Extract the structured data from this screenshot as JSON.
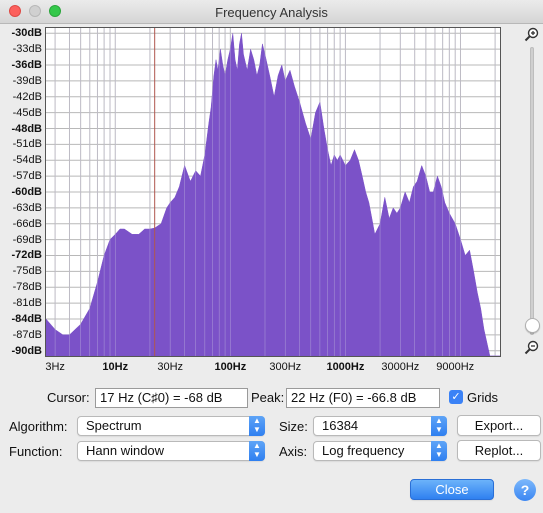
{
  "window": {
    "title": "Frequency Analysis"
  },
  "chart_data": {
    "type": "area",
    "title": "",
    "xlabel": "",
    "ylabel": "",
    "x_scale": "log",
    "xlim": [
      2.5,
      22050
    ],
    "ylim": [
      -91,
      -29
    ],
    "grid": true,
    "color": "#7b52c8",
    "y_ticks": [
      "-30dB",
      "-33dB",
      "-36dB",
      "-39dB",
      "-42dB",
      "-45dB",
      "-48dB",
      "-51dB",
      "-54dB",
      "-57dB",
      "-60dB",
      "-63dB",
      "-66dB",
      "-69dB",
      "-72dB",
      "-75dB",
      "-78dB",
      "-81dB",
      "-84dB",
      "-87dB",
      "-90dB"
    ],
    "y_ticks_bold": [
      "-30dB",
      "-36dB",
      "-48dB",
      "-60dB",
      "-72dB",
      "-84dB",
      "-90dB"
    ],
    "x_ticks": [
      "3Hz",
      "10Hz",
      "30Hz",
      "100Hz",
      "300Hz",
      "1000Hz",
      "3000Hz",
      "9000Hz"
    ],
    "x_ticks_bold": [
      "10Hz",
      "100Hz",
      "1000Hz"
    ],
    "cursor_hz": 22,
    "points": [
      [
        2.5,
        -84
      ],
      [
        3,
        -86
      ],
      [
        3.5,
        -87
      ],
      [
        4,
        -87
      ],
      [
        5,
        -85
      ],
      [
        6,
        -82
      ],
      [
        7,
        -77
      ],
      [
        8,
        -72
      ],
      [
        9,
        -69
      ],
      [
        10,
        -68
      ],
      [
        11,
        -67
      ],
      [
        12,
        -67
      ],
      [
        14,
        -68
      ],
      [
        16,
        -68
      ],
      [
        18,
        -67
      ],
      [
        20,
        -67
      ],
      [
        22,
        -66.8
      ],
      [
        25,
        -66
      ],
      [
        28,
        -63
      ],
      [
        30,
        -62
      ],
      [
        33,
        -61
      ],
      [
        36,
        -59
      ],
      [
        40,
        -55
      ],
      [
        45,
        -58
      ],
      [
        50,
        -56
      ],
      [
        55,
        -57
      ],
      [
        60,
        -53
      ],
      [
        65,
        -47
      ],
      [
        68,
        -44
      ],
      [
        72,
        -38
      ],
      [
        75,
        -35
      ],
      [
        78,
        -37
      ],
      [
        82,
        -33
      ],
      [
        86,
        -36
      ],
      [
        90,
        -38
      ],
      [
        95,
        -35
      ],
      [
        100,
        -33
      ],
      [
        105,
        -30
      ],
      [
        110,
        -35
      ],
      [
        115,
        -37
      ],
      [
        120,
        -32
      ],
      [
        125,
        -30
      ],
      [
        130,
        -34
      ],
      [
        140,
        -37
      ],
      [
        150,
        -33
      ],
      [
        160,
        -35
      ],
      [
        170,
        -38
      ],
      [
        180,
        -36
      ],
      [
        190,
        -32
      ],
      [
        200,
        -34
      ],
      [
        220,
        -38
      ],
      [
        240,
        -42
      ],
      [
        260,
        -38
      ],
      [
        280,
        -36
      ],
      [
        300,
        -39
      ],
      [
        330,
        -37
      ],
      [
        360,
        -40
      ],
      [
        400,
        -43
      ],
      [
        450,
        -47
      ],
      [
        500,
        -50
      ],
      [
        550,
        -45
      ],
      [
        600,
        -43
      ],
      [
        650,
        -48
      ],
      [
        700,
        -52
      ],
      [
        750,
        -55
      ],
      [
        800,
        -53
      ],
      [
        850,
        -54
      ],
      [
        900,
        -53
      ],
      [
        1000,
        -55
      ],
      [
        1100,
        -54
      ],
      [
        1200,
        -52
      ],
      [
        1300,
        -54
      ],
      [
        1400,
        -57
      ],
      [
        1500,
        -60
      ],
      [
        1600,
        -62
      ],
      [
        1700,
        -65
      ],
      [
        1800,
        -68
      ],
      [
        2000,
        -66
      ],
      [
        2200,
        -61
      ],
      [
        2400,
        -65
      ],
      [
        2600,
        -63
      ],
      [
        2800,
        -64
      ],
      [
        3000,
        -63
      ],
      [
        3300,
        -60
      ],
      [
        3600,
        -62
      ],
      [
        3900,
        -59
      ],
      [
        4200,
        -58
      ],
      [
        4600,
        -55
      ],
      [
        5000,
        -57
      ],
      [
        5400,
        -60
      ],
      [
        5800,
        -60
      ],
      [
        6300,
        -57
      ],
      [
        6800,
        -59
      ],
      [
        7300,
        -62
      ],
      [
        8000,
        -64
      ],
      [
        9000,
        -66
      ],
      [
        10000,
        -69
      ],
      [
        11000,
        -72
      ],
      [
        12000,
        -71
      ],
      [
        13000,
        -75
      ],
      [
        14000,
        -79
      ],
      [
        15000,
        -82
      ],
      [
        16000,
        -86
      ],
      [
        18000,
        -91
      ],
      [
        22050,
        -91
      ]
    ]
  },
  "cursor": {
    "label": "Cursor:",
    "value": "17 Hz (C♯0) = -68 dB"
  },
  "peak": {
    "label": "Peak:",
    "value": "22 Hz (F0) = -66.8 dB"
  },
  "grids": {
    "label": "Grids",
    "checked": true
  },
  "algorithm": {
    "label": "Algorithm:",
    "value": "Spectrum"
  },
  "function": {
    "label": "Function:",
    "value": "Hann window"
  },
  "size": {
    "label": "Size:",
    "value": "16384"
  },
  "axis": {
    "label": "Axis:",
    "value": "Log frequency"
  },
  "buttons": {
    "export": "Export...",
    "replot": "Replot...",
    "close": "Close",
    "help": "?"
  },
  "icons": {
    "zoom_in": "zoom-in-icon",
    "zoom_out": "zoom-out-icon",
    "close_window": "close-window-icon",
    "minimize_window": "minimize-window-icon",
    "maximize_window": "maximize-window-icon",
    "checkbox": "checkbox-checked-icon",
    "dropdown": "dropdown-arrows-icon",
    "help": "help-icon"
  },
  "zoom_level": 0.97
}
